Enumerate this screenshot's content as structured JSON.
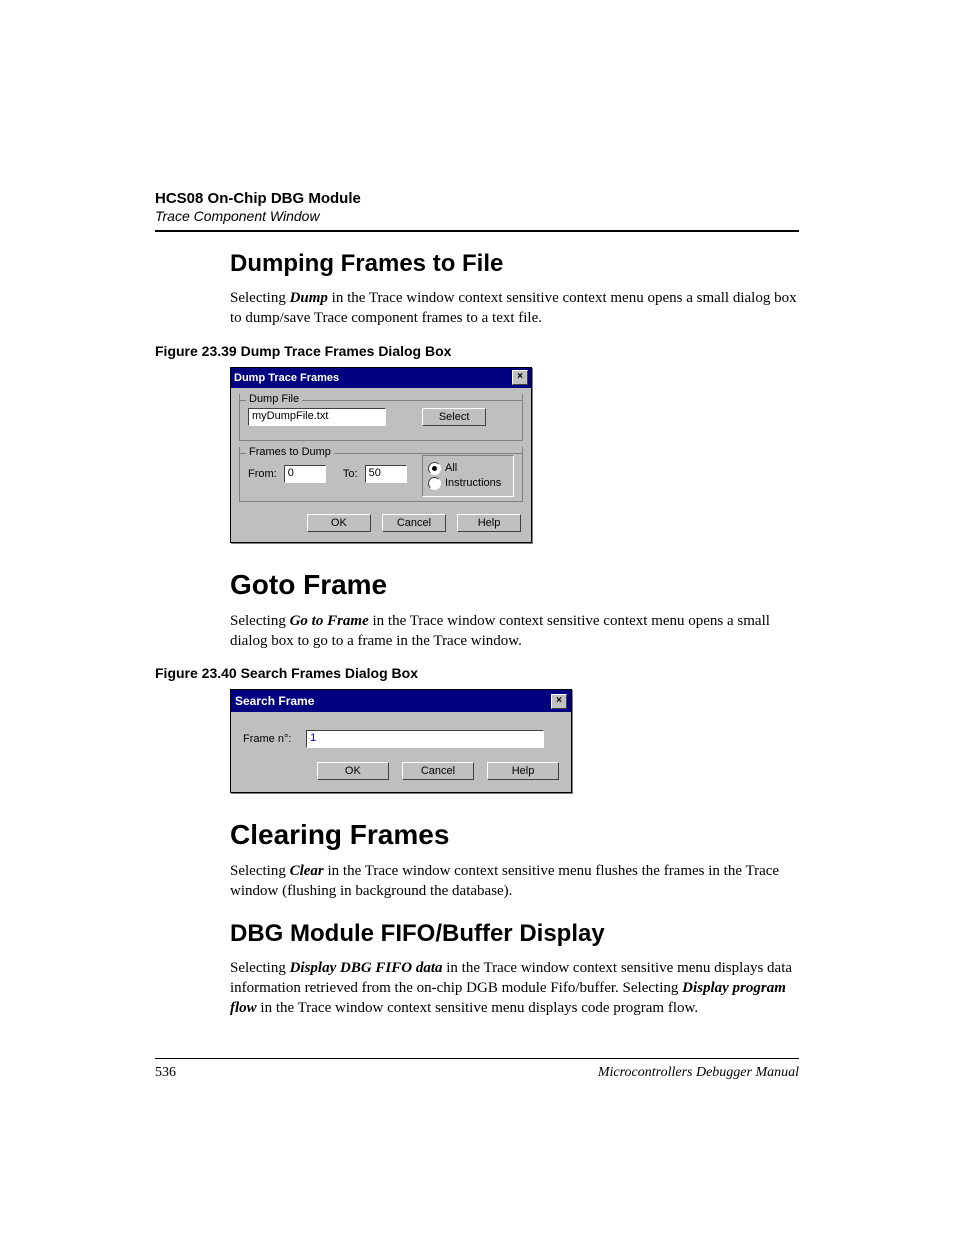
{
  "header": {
    "bold": "HCS08 On-Chip DBG Module",
    "italic": "Trace Component Window"
  },
  "sections": {
    "dump": {
      "title": "Dumping Frames to File",
      "para_pre": "Selecting ",
      "para_em": "Dump",
      "para_post": " in the Trace window context sensitive context menu opens a small dialog box to dump/save Trace component frames to a text file.",
      "fig_caption": "Figure 23.39  Dump Trace Frames Dialog Box"
    },
    "goto": {
      "title": "Goto Frame",
      "para_pre": "Selecting ",
      "para_em": "Go to Frame",
      "para_post": " in the Trace window context sensitive context menu opens a small dialog box to go to a frame in the Trace window.",
      "fig_caption": "Figure 23.40  Search Frames Dialog Box"
    },
    "clear": {
      "title": "Clearing Frames",
      "para_pre": "Selecting ",
      "para_em": "Clear",
      "para_post": " in the Trace window context sensitive menu flushes the frames in the Trace window (flushing in background the database)."
    },
    "fifo": {
      "title": "DBG Module FIFO/Buffer Display",
      "p_pre": "Selecting ",
      "p_em1": "Display DBG FIFO data",
      "p_mid": " in the Trace window context sensitive menu displays data information retrieved from the on-chip DGB module Fifo/buffer. Selecting ",
      "p_em2": "Display program flow",
      "p_post": " in the Trace window context sensitive menu displays code program flow."
    }
  },
  "dlg1": {
    "title": "Dump Trace Frames",
    "close": "×",
    "group1": "Dump File",
    "filename": "myDumpFile.txt",
    "select": "Select",
    "group2": "Frames to Dump",
    "from_lbl": "From:",
    "from_val": "0",
    "to_lbl": "To:",
    "to_val": "50",
    "radio_all": "All",
    "radio_instr": "Instructions",
    "ok": "OK",
    "cancel": "Cancel",
    "help": "Help"
  },
  "dlg2": {
    "title": "Search Frame",
    "close": "×",
    "label": "Frame n°:",
    "value": "1",
    "ok": "OK",
    "cancel": "Cancel",
    "help": "Help"
  },
  "footer": {
    "page": "536",
    "manual": "Microcontrollers Debugger Manual"
  }
}
